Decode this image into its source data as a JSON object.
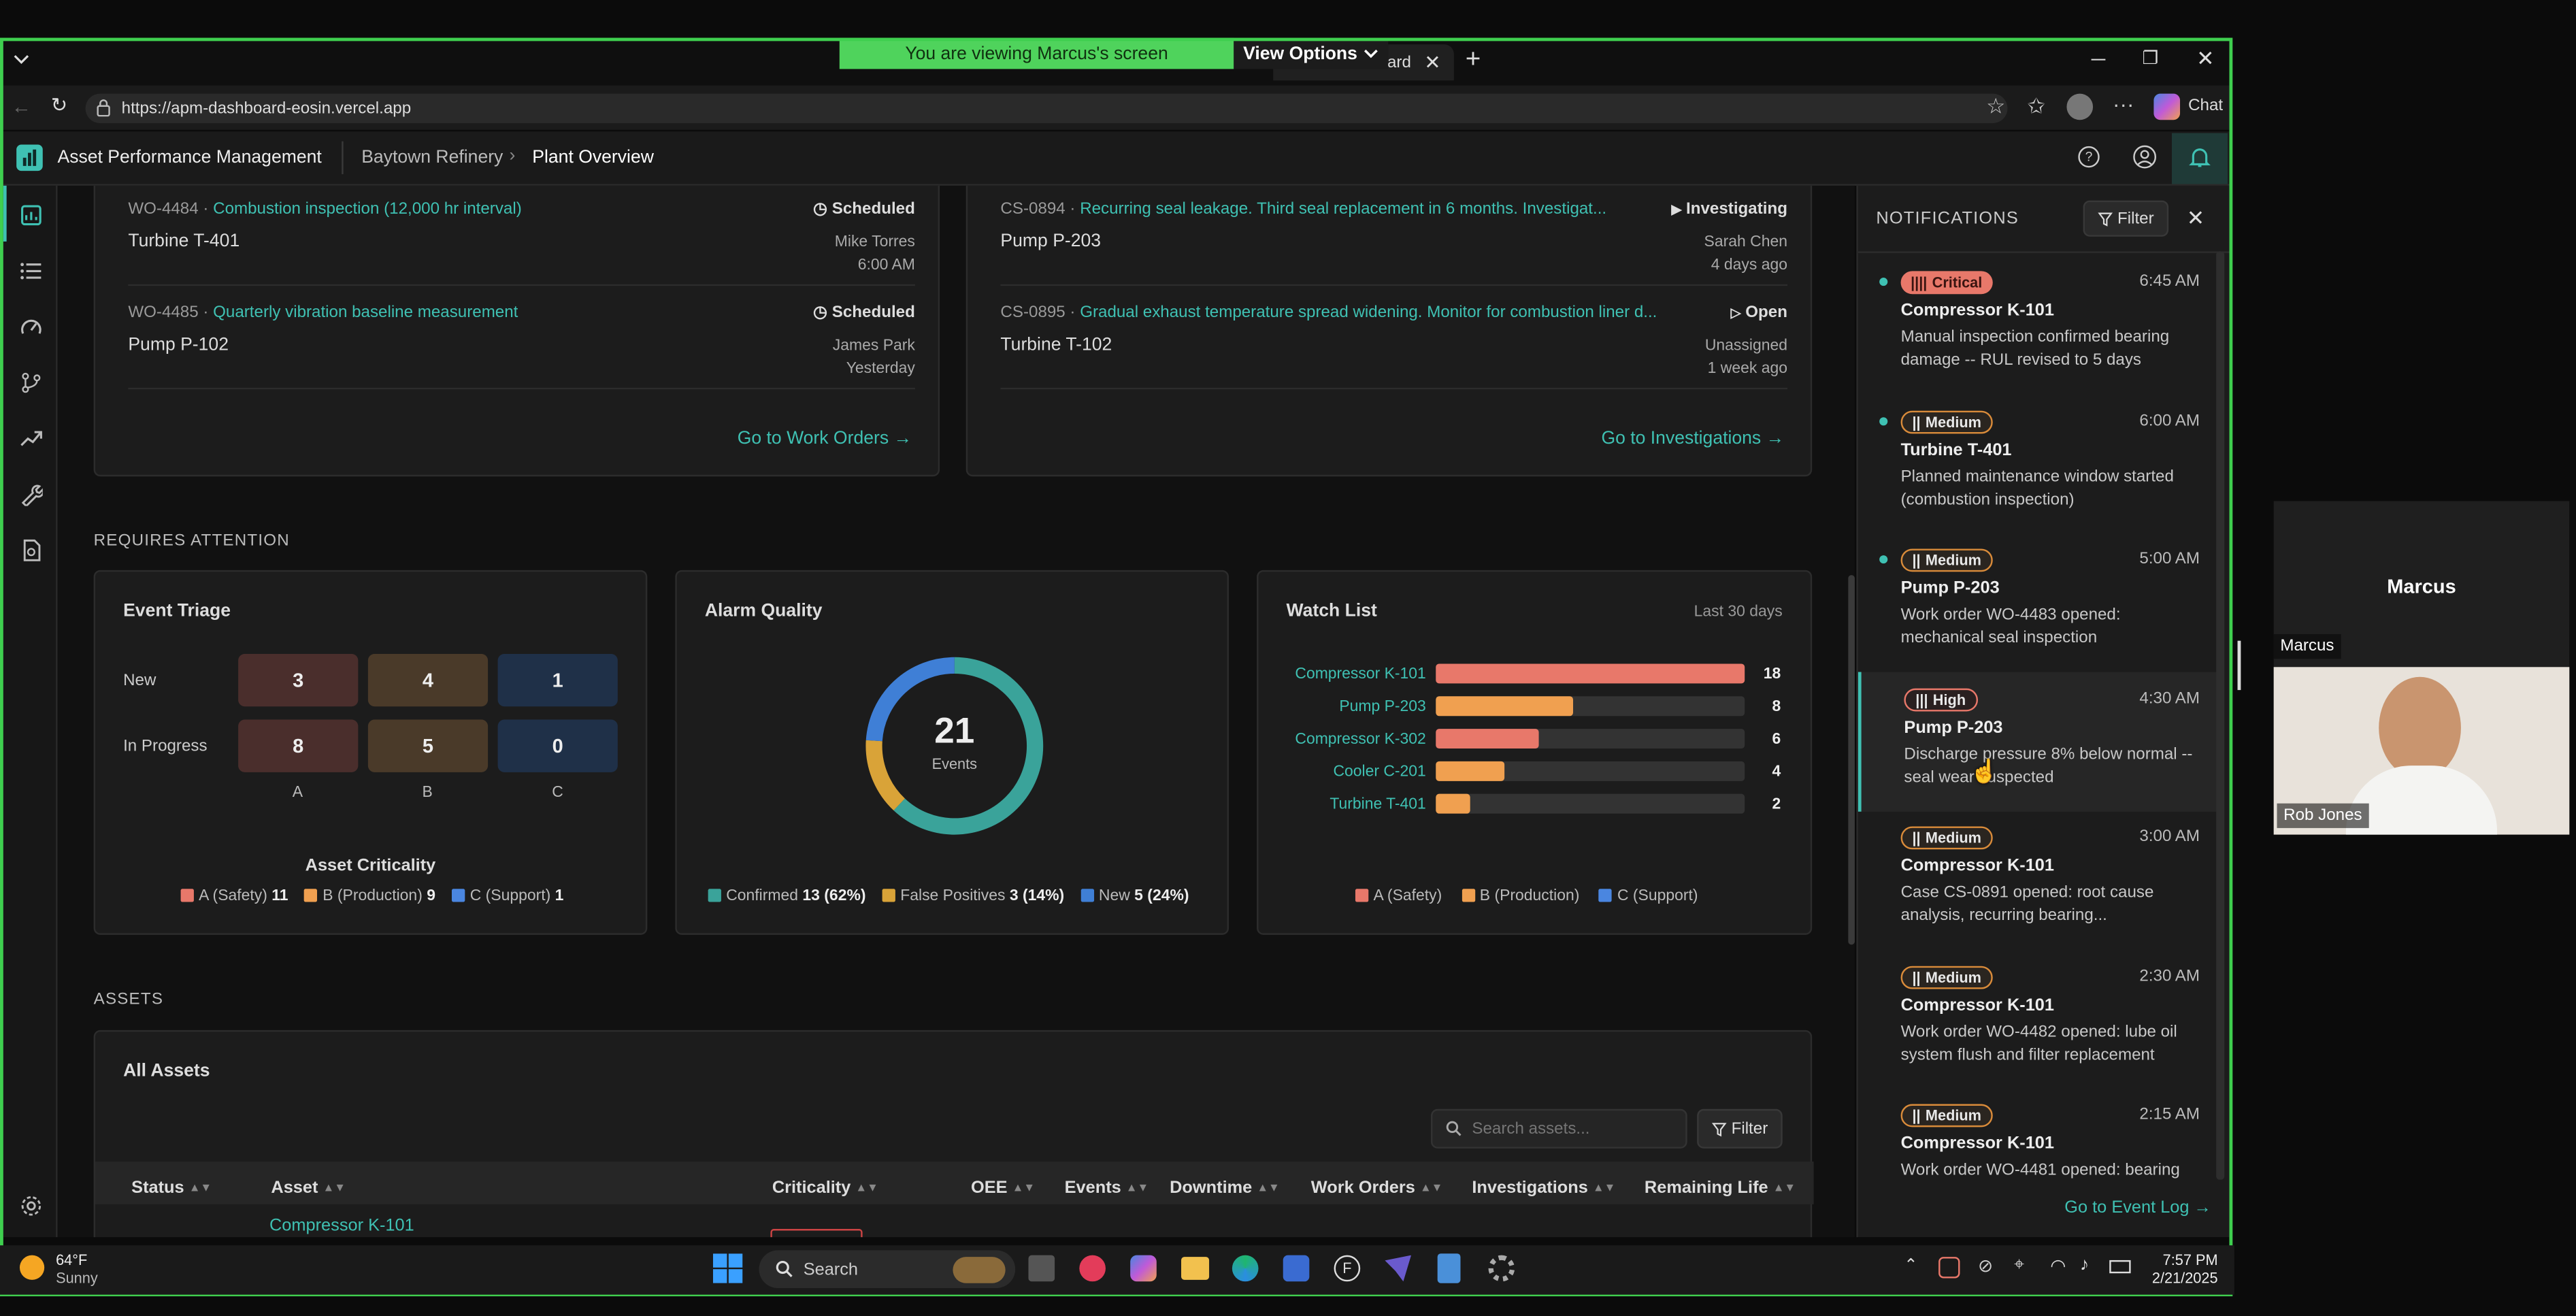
{
  "share": {
    "banner": "You are viewing Marcus's screen",
    "view_options": "View Options"
  },
  "browser": {
    "tab_title": "oard",
    "url": "https://apm-dashboard-eosin.vercel.app",
    "chat": "Chat"
  },
  "app": {
    "title": "Asset Performance Management",
    "breadcrumb": [
      "Baytown Refinery",
      "Plant Overview"
    ]
  },
  "work_orders": [
    {
      "id": "WO-4484 ·",
      "title": "Combustion inspection (12,000 hr interval)",
      "asset": "Turbine T-401",
      "status": "Scheduled",
      "who": "Mike Torres",
      "when": "6:00 AM"
    },
    {
      "id": "WO-4485 ·",
      "title": "Quarterly vibration baseline measurement",
      "asset": "Pump P-102",
      "status": "Scheduled",
      "who": "James Park",
      "when": "Yesterday"
    }
  ],
  "work_orders_link": "Go to Work Orders →",
  "investigations": [
    {
      "id": "CS-0894 ·",
      "title": "Recurring seal leakage. Third seal replacement in 6 months. Investigat...",
      "asset": "Pump P-203",
      "status": "Investigating",
      "who": "Sarah Chen",
      "when": "4 days ago"
    },
    {
      "id": "CS-0895 ·",
      "title": "Gradual exhaust temperature spread widening. Monitor for combustion liner d...",
      "asset": "Turbine T-102",
      "status": "Open",
      "who": "Unassigned",
      "when": "1 week ago"
    }
  ],
  "investigations_link": "Go to Investigations →",
  "requires_attention": "REQUIRES ATTENTION",
  "triage": {
    "title": "Event Triage",
    "rows": [
      {
        "label": "New",
        "values": [
          "3",
          "4",
          "1"
        ]
      },
      {
        "label": "In Progress",
        "values": [
          "8",
          "5",
          "0"
        ]
      }
    ],
    "cols": [
      "A",
      "B",
      "C"
    ],
    "criticality_title": "Asset Criticality",
    "legend": [
      {
        "label": "A (Safety)",
        "count": "11"
      },
      {
        "label": "B (Production)",
        "count": "9"
      },
      {
        "label": "C (Support)",
        "count": "1"
      }
    ]
  },
  "alarm": {
    "title": "Alarm Quality",
    "total": "21",
    "total_label": "Events",
    "legend": [
      {
        "label": "Confirmed",
        "value": "13 (62%)"
      },
      {
        "label": "False Positives",
        "value": "3 (14%)"
      },
      {
        "label": "New",
        "value": "5 (24%)"
      }
    ]
  },
  "chart_data": {
    "type": "bar",
    "title": "Watch List",
    "subtitle": "Last 30 days",
    "categories": [
      "Compressor K-101",
      "Pump P-203",
      "Compressor K-302",
      "Cooler C-201",
      "Turbine T-401"
    ],
    "values": [
      18,
      8,
      6,
      4,
      2
    ],
    "classes": [
      "A",
      "B",
      "A",
      "B",
      "B"
    ],
    "xlim": [
      0,
      18
    ],
    "legend": [
      "A (Safety)",
      "B (Production)",
      "C (Support)"
    ]
  },
  "assets": {
    "section": "ASSETS",
    "title": "All Assets",
    "search_placeholder": "Search assets...",
    "filter": "Filter",
    "columns": [
      "Status",
      "Asset",
      "Criticality",
      "OEE",
      "Events",
      "Downtime",
      "Work Orders",
      "Investigations",
      "Remaining Life"
    ],
    "first_row_asset": "Compressor K-101"
  },
  "notifications": {
    "title": "NOTIFICATIONS",
    "filter": "Filter",
    "items": [
      {
        "sev": "Critical",
        "time": "6:45 AM",
        "asset": "Compressor K-101",
        "msg": "Manual inspection confirmed bearing damage -- RUL revised to 5 days",
        "unread": true
      },
      {
        "sev": "Medium",
        "time": "6:00 AM",
        "asset": "Turbine T-401",
        "msg": "Planned maintenance window started (combustion inspection)",
        "unread": true
      },
      {
        "sev": "Medium",
        "time": "5:00 AM",
        "asset": "Pump P-203",
        "msg": "Work order WO-4483 opened: mechanical seal inspection",
        "unread": true
      },
      {
        "sev": "High",
        "time": "4:30 AM",
        "asset": "Pump P-203",
        "msg": "Discharge pressure 8% below normal -- seal wear suspected",
        "unread": false
      },
      {
        "sev": "Medium",
        "time": "3:00 AM",
        "asset": "Compressor K-101",
        "msg": "Case CS-0891 opened: root cause analysis, recurring bearing...",
        "unread": false
      },
      {
        "sev": "Medium",
        "time": "2:30 AM",
        "asset": "Compressor K-101",
        "msg": "Work order WO-4482 opened: lube oil system flush and filter replacement",
        "unread": false
      },
      {
        "sev": "Medium",
        "time": "2:15 AM",
        "asset": "Compressor K-101",
        "msg": "Work order WO-4481 opened: bearing",
        "unread": false
      }
    ],
    "link": "Go to Event Log →"
  },
  "video": {
    "name": "Marcus",
    "label": "Marcus",
    "participant": "Rob Jones"
  },
  "taskbar": {
    "temp": "64°F",
    "weather": "Sunny",
    "search": "Search",
    "time": "7:57 PM",
    "date": "2/21/2025"
  },
  "colors": {
    "accent": "#3fc1b3",
    "safety": "#e8786a",
    "production": "#f0a050",
    "support": "#4a86e0",
    "share": "#4fd35c"
  }
}
